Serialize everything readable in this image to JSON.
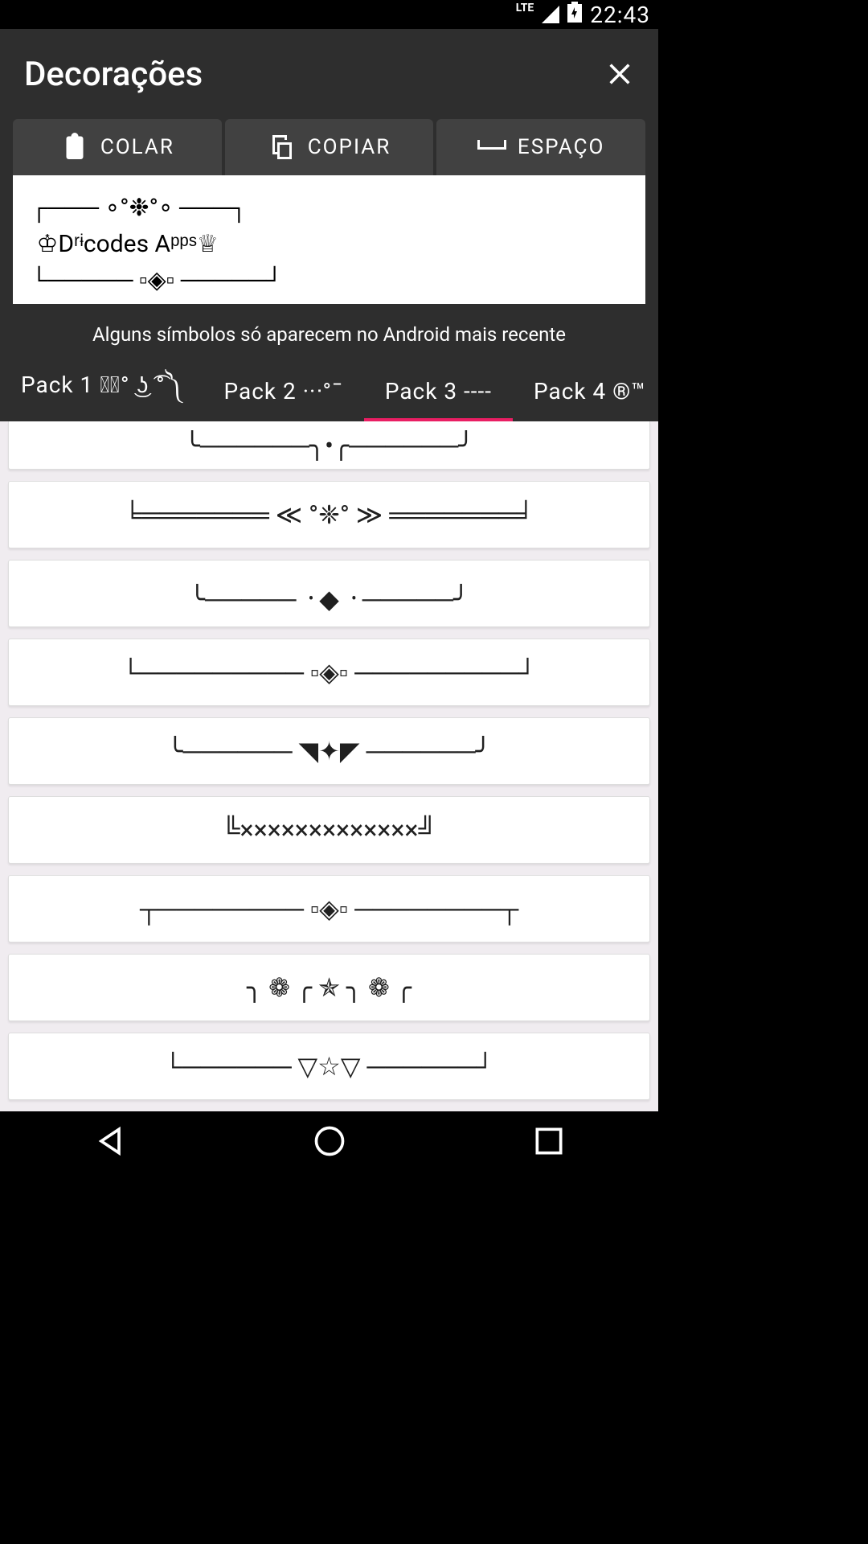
{
  "status": {
    "network": "LTE",
    "time": "22:43"
  },
  "header": {
    "title": "Decorações"
  },
  "toolbar": {
    "paste": "COLAR",
    "copy": "COPIAR",
    "space": "ESPAÇO"
  },
  "preview": "┌─── ∘°❉°∘ ───┐\n ♔Dʳᶤcodes Aᵖᵖˢ♕\n└───── ▫◈▫ ─────┘",
  "hint": "Alguns símbolos só aparecem no Android mais recente",
  "tabs": [
    {
      "label": "Pack 1 ༼͡° ͜ʖ ͡°༽"
    },
    {
      "label": "Pack 2 ··ᐧ°¯"
    },
    {
      "label": "Pack 3 ----",
      "active": true
    },
    {
      "label": "Pack 4 ®™"
    }
  ],
  "decorations": [
    "╰──────╮•╭──────╯",
    "╘═══════ ≪ °❈° ≫ ═══════╛",
    "╰───── ᠂ ◆ ᠂ ─────╯",
    "└───────── ▫◈▫ ─────────┘",
    "╰────── ◥✦◤ ──────╯",
    "╚×××××××××××××╝",
    "┬──────── ▫◈▫ ────────┬",
    "╮ ❁ ╭ ✯ ╮ ❁ ╭",
    "└────── ▽☆▽ ──────┘"
  ]
}
